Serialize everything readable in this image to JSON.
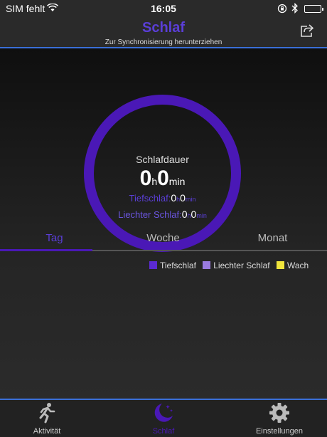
{
  "status_bar": {
    "carrier": "SIM fehlt",
    "time": "16:05"
  },
  "nav": {
    "title": "Schlaf",
    "subtitle": "Zur Synchronisierung herunterziehen"
  },
  "summary": {
    "duration_label": "Schlafdauer",
    "total_hours": "0",
    "total_minutes": "0",
    "hour_unit": "h",
    "minute_unit": "min",
    "deep_label": "Tiefschlaf:",
    "deep_hours": "0",
    "deep_minutes": "0",
    "light_label": "Liechter Schlaf:",
    "light_hours": "0",
    "light_minutes": "0"
  },
  "tabs": [
    {
      "label": "Tag",
      "active": true
    },
    {
      "label": "Woche",
      "active": false
    },
    {
      "label": "Monat",
      "active": false
    }
  ],
  "legend": [
    {
      "label": "Tiefschlaf",
      "color": "#5b2ad1"
    },
    {
      "label": "Liechter Schlaf",
      "color": "#9a7be0"
    },
    {
      "label": "Wach",
      "color": "#f0e53c"
    }
  ],
  "tab_bar": [
    {
      "label": "Aktivität",
      "icon": "running-icon",
      "active": false
    },
    {
      "label": "Schlaf",
      "icon": "moon-stars-icon",
      "active": true
    },
    {
      "label": "Einstellungen",
      "icon": "gear-icon",
      "active": false
    }
  ],
  "colors": {
    "accent": "#4a18b6",
    "divider": "#3a6fd8",
    "title": "#5a3ed6"
  }
}
